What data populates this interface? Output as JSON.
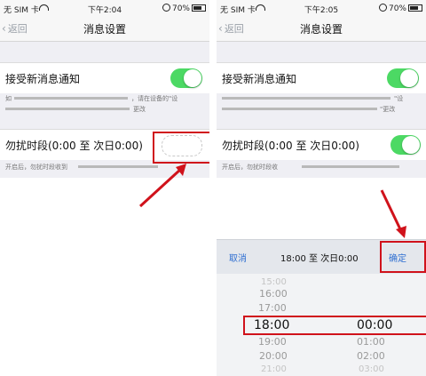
{
  "left": {
    "status": {
      "carrier": "无 SIM 卡",
      "time": "下午2:04",
      "battery": "70%"
    },
    "nav": {
      "back": "返回",
      "title": "消息设置"
    },
    "notify_label": "接受新消息通知",
    "notify_desc_a": "如",
    "notify_desc_b": "，请在设备的\"设",
    "notify_desc_c": "更改",
    "dnd_label": "勿扰时段(0:00 至 次日0:00)",
    "dnd_desc": "开启后，勿扰时段收到",
    "notify_on": true,
    "dnd_on": false
  },
  "right": {
    "status": {
      "carrier": "无 SIM 卡",
      "time": "下午2:05",
      "battery": "70%"
    },
    "nav": {
      "back": "返回",
      "title": "消息设置"
    },
    "notify_label": "接受新消息通知",
    "notify_desc_a": "\"设",
    "notify_desc_b": "\"更改",
    "dnd_label": "勿扰时段(0:00 至 次日0:00)",
    "dnd_desc": "开启后，勿扰时段收",
    "notify_on": true,
    "dnd_on": true,
    "picker": {
      "cancel": "取消",
      "range": "18:00 至 次日0:00",
      "confirm": "确定",
      "hours": [
        "15:00",
        "16:00",
        "17:00",
        "18:00",
        "19:00",
        "20:00",
        "21:00"
      ],
      "minutes": [
        "00:00",
        "01:00",
        "02:00",
        "03:00"
      ]
    }
  },
  "colors": {
    "accent": "#4cd964",
    "annotation": "#d0121b",
    "link": "#2f6fd1"
  }
}
